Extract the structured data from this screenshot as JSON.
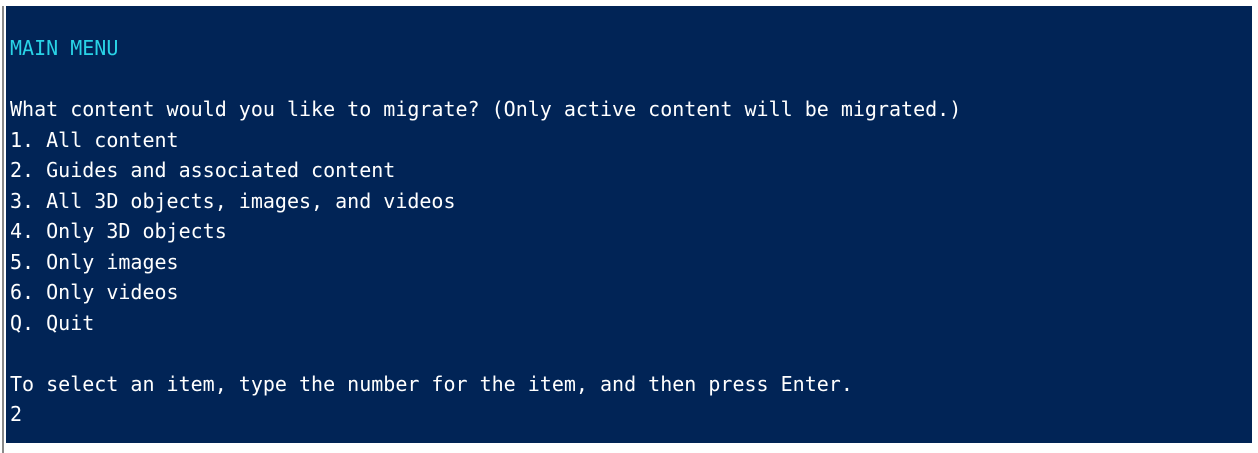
{
  "console": {
    "title": "MAIN MENU",
    "prompt": "What content would you like to migrate? (Only active content will be migrated.)",
    "options": [
      "1. All content",
      "2. Guides and associated content",
      "3. All 3D objects, images, and videos",
      "4. Only 3D objects",
      "5. Only images",
      "6. Only videos",
      "Q. Quit"
    ],
    "instruction": "To select an item, type the number for the item, and then press Enter.",
    "input_value": "2",
    "colors": {
      "background": "#012456",
      "title": "#29d3e6",
      "text": "#ffffff"
    }
  }
}
